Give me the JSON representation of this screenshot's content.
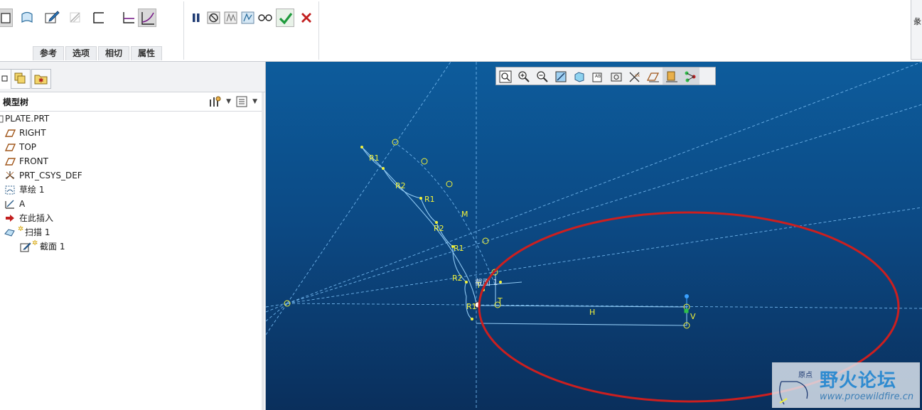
{
  "ribbon": {
    "tabs": [
      "参考",
      "选项",
      "相切",
      "属性"
    ],
    "corner_glyph": "彖"
  },
  "model_tree": {
    "title": "模型树",
    "items": [
      {
        "label": "PLATE.PRT",
        "icon": "part-icon"
      },
      {
        "label": "RIGHT",
        "icon": "datum-plane-icon"
      },
      {
        "label": "TOP",
        "icon": "datum-plane-icon"
      },
      {
        "label": "FRONT",
        "icon": "datum-plane-icon"
      },
      {
        "label": "PRT_CSYS_DEF",
        "icon": "coordinate-system-icon"
      },
      {
        "label": "草绘 1",
        "icon": "sketch-icon"
      },
      {
        "label": "A",
        "icon": "datum-axis-icon"
      },
      {
        "label": "在此插入",
        "icon": "insert-here-arrow-icon"
      },
      {
        "label": "扫描 1",
        "icon": "sweep-icon"
      },
      {
        "label": "截面 1",
        "icon": "section-icon"
      }
    ]
  },
  "graphics": {
    "sketch_labels": {
      "r1": "R1",
      "r2": "R2",
      "m": "M",
      "t": "T",
      "h": "H",
      "v": "V",
      "section": "截面 1"
    },
    "watermark": {
      "title": "野火论坛",
      "url": "www.proewildfire.cn",
      "origin": "原点"
    },
    "colors": {
      "background_top": "#0d5c9c",
      "background_bottom": "#0a2f5c",
      "highlight_ellipse": "#cc1f1f",
      "sketch": "#f2f23a",
      "construction": "#6fb3ea"
    }
  }
}
